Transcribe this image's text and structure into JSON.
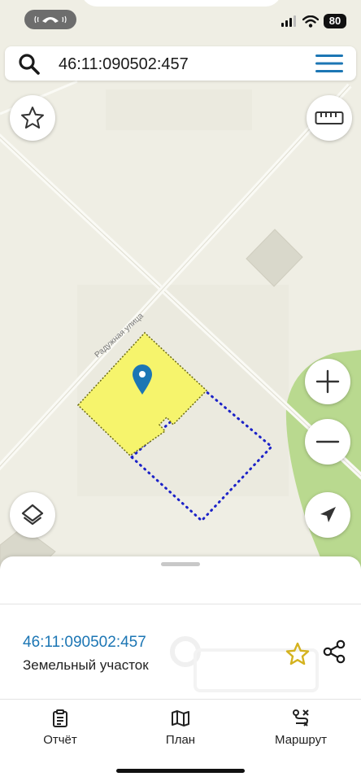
{
  "status_bar": {
    "battery_level": "80",
    "call_icon": "phone-call-icon"
  },
  "search": {
    "query": "46:11:090502:457",
    "icon": "search-icon",
    "menu_icon": "hamburger-menu-icon"
  },
  "map": {
    "street_label": "Радужная улица",
    "controls": [
      "favorites-star-icon",
      "ruler-icon",
      "zoom-in-icon",
      "zoom-out-icon",
      "layers-icon",
      "locate-arrow-icon"
    ],
    "colors": {
      "background": "#efeee4",
      "road": "#ffffff",
      "building": "#d9d8cb",
      "park": "#b9d98f",
      "parcel_fill": "#f6f46c",
      "parcel_outline": "#6a6a14",
      "boundary_dotted": "#1c22c8",
      "marker": "#1c76b4"
    }
  },
  "sheet": {
    "parcel_id": "46:11:090502:457",
    "parcel_type": "Земельный участок",
    "favorite_icon": "star-outline-icon",
    "share_icon": "share-icon",
    "accent_star": "#d4b21f"
  },
  "tabs": [
    {
      "label": "Отчёт",
      "icon": "clipboard-report-icon"
    },
    {
      "label": "План",
      "icon": "map-plan-icon"
    },
    {
      "label": "Маршрут",
      "icon": "route-icon"
    }
  ]
}
